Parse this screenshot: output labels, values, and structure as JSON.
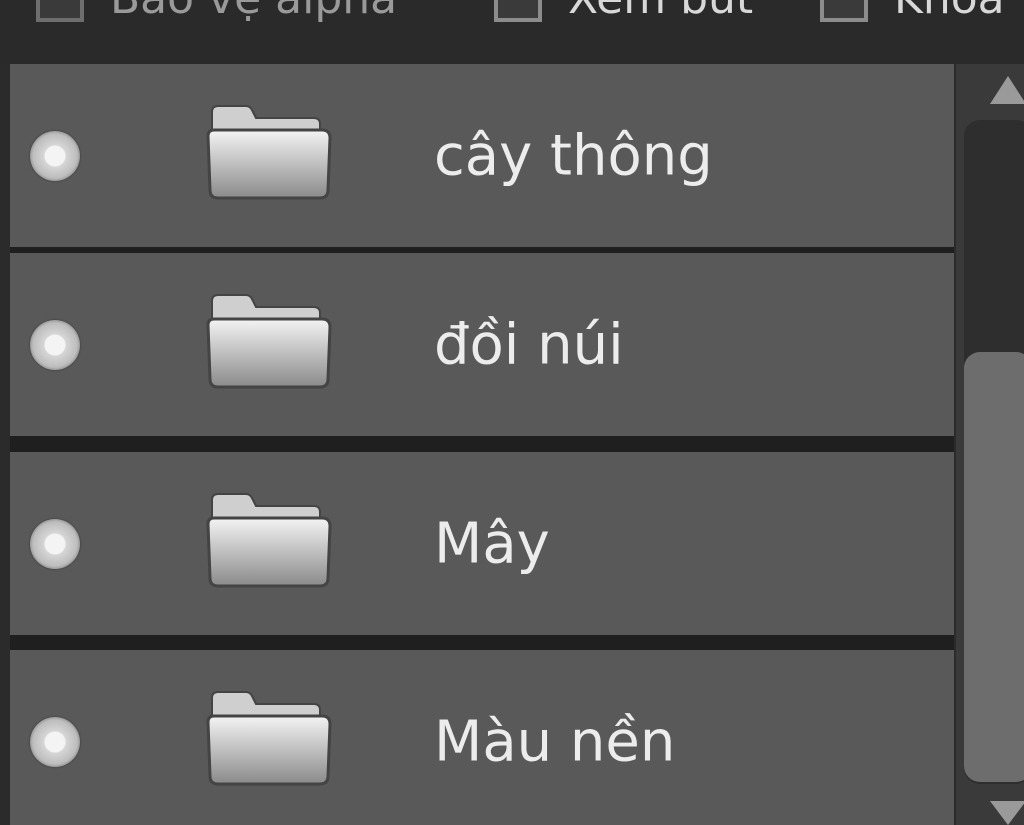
{
  "toolbar": {
    "checkboxes": [
      {
        "label": "Bảo vệ alpha",
        "checked": false
      },
      {
        "label": "Xem bút",
        "checked": false
      },
      {
        "label": "Khóa",
        "checked": false
      }
    ]
  },
  "layers": [
    {
      "name": "cây thông",
      "type": "folder",
      "visible": true
    },
    {
      "name": "đồi núi",
      "type": "folder",
      "visible": true
    },
    {
      "name": "Mây",
      "type": "folder",
      "visible": true
    },
    {
      "name": "Màu nền",
      "type": "folder",
      "visible": true
    }
  ],
  "icons": {
    "visibility": "visibility-dot-icon",
    "folder": "folder-icon",
    "scroll_up": "scroll-up-arrow-icon",
    "scroll_down": "scroll-down-arrow-icon"
  },
  "colors": {
    "background": "#2b2b2b",
    "row": "#595959",
    "text": "#ececec"
  }
}
